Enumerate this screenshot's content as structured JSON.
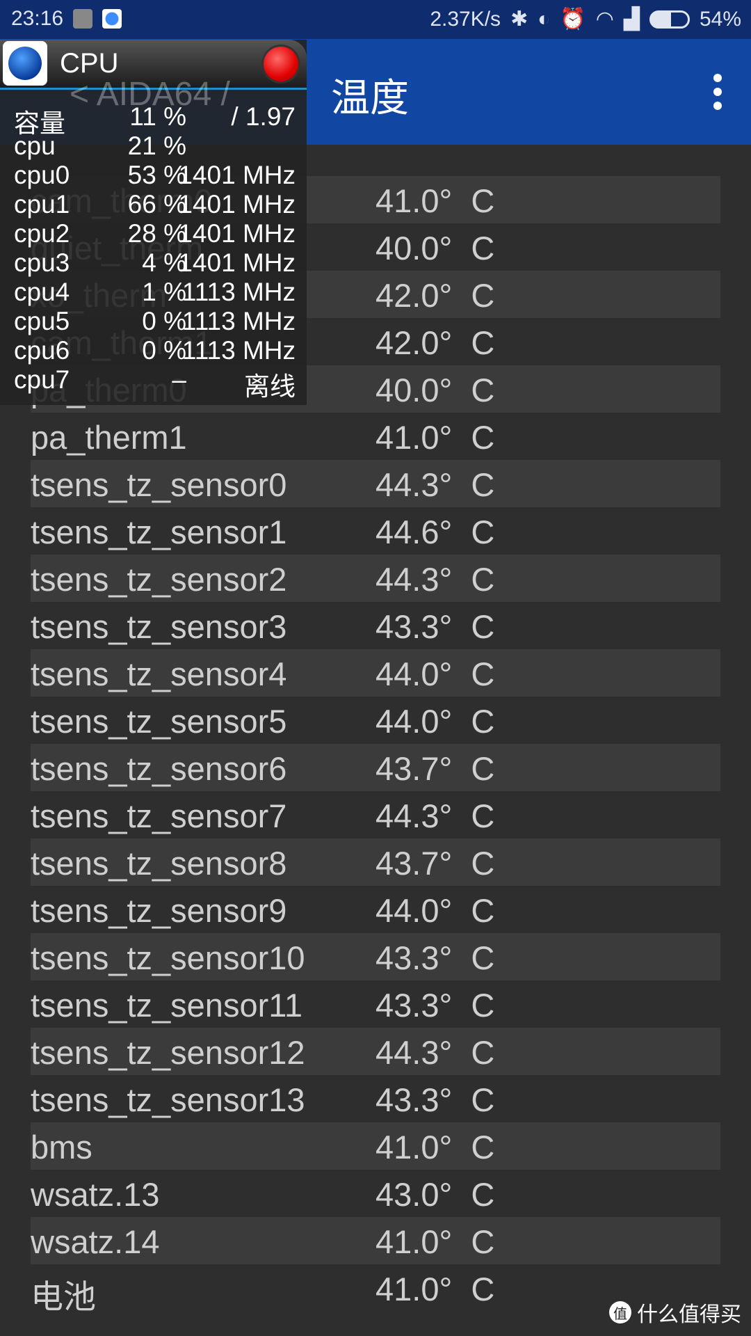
{
  "status_bar": {
    "time": "23:16",
    "speed": "2.37K/s",
    "battery": "54%",
    "icons": [
      "shield-icon",
      "aida-icon",
      "bluetooth-icon",
      "vibrate-icon",
      "alarm-icon",
      "wifi-icon",
      "signal-icon",
      "battery-icon"
    ]
  },
  "app_bar": {
    "back_title": "< AIDA64 /",
    "title": "温度",
    "menu_icon": "more-vert-icon",
    "color": "#1146a3"
  },
  "sensors": [
    {
      "label": "cam_therm0",
      "value": "41.0° C"
    },
    {
      "label": "quiet_therm",
      "value": "40.0° C"
    },
    {
      "label": "xo_therm",
      "value": "42.0° C"
    },
    {
      "label": "cam_therm1",
      "value": "42.0° C"
    },
    {
      "label": "pa_therm0",
      "value": "40.0° C"
    },
    {
      "label": "pa_therm1",
      "value": "41.0° C"
    },
    {
      "label": "tsens_tz_sensor0",
      "value": "44.3° C"
    },
    {
      "label": "tsens_tz_sensor1",
      "value": "44.6° C"
    },
    {
      "label": "tsens_tz_sensor2",
      "value": "44.3° C"
    },
    {
      "label": "tsens_tz_sensor3",
      "value": "43.3° C"
    },
    {
      "label": "tsens_tz_sensor4",
      "value": "44.0° C"
    },
    {
      "label": "tsens_tz_sensor5",
      "value": "44.0° C"
    },
    {
      "label": "tsens_tz_sensor6",
      "value": "43.7° C"
    },
    {
      "label": "tsens_tz_sensor7",
      "value": "44.3° C"
    },
    {
      "label": "tsens_tz_sensor8",
      "value": "43.7° C"
    },
    {
      "label": "tsens_tz_sensor9",
      "value": "44.0° C"
    },
    {
      "label": "tsens_tz_sensor10",
      "value": "43.3° C"
    },
    {
      "label": "tsens_tz_sensor11",
      "value": "43.3° C"
    },
    {
      "label": "tsens_tz_sensor12",
      "value": "44.3° C"
    },
    {
      "label": "tsens_tz_sensor13",
      "value": "43.3° C"
    },
    {
      "label": "bms",
      "value": "41.0° C"
    },
    {
      "label": "wsatz.13",
      "value": "43.0° C"
    },
    {
      "label": "wsatz.14",
      "value": "41.0° C"
    },
    {
      "label": "电池",
      "value": "41.0° C"
    }
  ],
  "overlay": {
    "title": "CPU",
    "rows": [
      {
        "name": "容量",
        "pct": "11 %",
        "extra": "/ 1.97"
      },
      {
        "name": "cpu",
        "pct": "21 %",
        "extra": ""
      },
      {
        "name": "cpu0",
        "pct": "53 %",
        "extra": "1401 MHz"
      },
      {
        "name": "cpu1",
        "pct": "66 %",
        "extra": "1401 MHz"
      },
      {
        "name": "cpu2",
        "pct": "28 %",
        "extra": "1401 MHz"
      },
      {
        "name": "cpu3",
        "pct": "4 %",
        "extra": "1401 MHz"
      },
      {
        "name": "cpu4",
        "pct": "1 %",
        "extra": "1113 MHz"
      },
      {
        "name": "cpu5",
        "pct": "0 %",
        "extra": "1113 MHz"
      },
      {
        "name": "cpu6",
        "pct": "0 %",
        "extra": "1113 MHz"
      },
      {
        "name": "cpu7",
        "pct": "–",
        "extra": "离线"
      }
    ]
  },
  "watermark": {
    "badge": "值",
    "text": "什么值得买"
  }
}
